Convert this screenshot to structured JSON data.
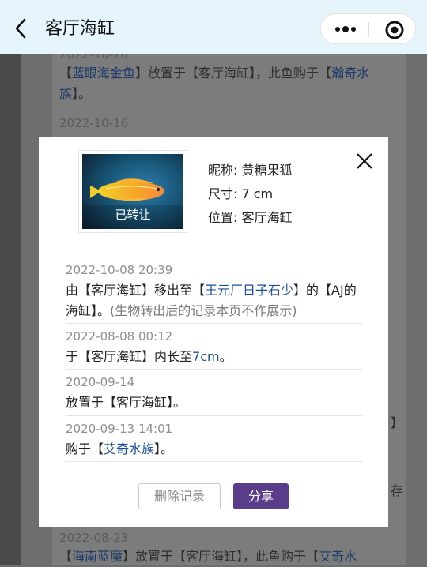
{
  "header": {
    "title": "客厅海缸",
    "back_icon": "chevron-left-icon",
    "more_icon": "more-dots-icon",
    "target_icon": "target-icon"
  },
  "background": {
    "entries": [
      {
        "date": "2022-10-20",
        "link": "蓝眼海金鱼",
        "text": "放置于【客厅海缸】，此鱼购于【",
        "link2": "瀚奇水族",
        "tail": "】。"
      },
      {
        "date": "2022-10-16"
      },
      {
        "date": "2022-08-23",
        "link": "海南蓝魔",
        "text": "放置于【客厅海缸】，此鱼购于【",
        "link2": "艾奇水",
        "tail": ""
      }
    ],
    "right_fragments": [
      "】",
      "存"
    ]
  },
  "modal": {
    "photo_stamp": "已转让",
    "nickname": "昵称: 黄糖果狐",
    "size": "尺寸: 7 cm",
    "location": "位置: 客厅海缸",
    "records": [
      {
        "date": "2022-10-08 20:39",
        "pre": "由【客厅海缸】移出至【",
        "link": "王元厂日子石少",
        "post": "】的【AJ的海缸】。",
        "note": "(生物转出后的记录本页不作展示)"
      },
      {
        "date": "2022-08-08 00:12",
        "pre": "于【客厅海缸】内长至",
        "link": "7cm",
        "post": "。"
      },
      {
        "date": "2020-09-14",
        "pre": "放置于【客厅海缸】。"
      },
      {
        "date": "2020-09-13 14:01",
        "pre": "购于【",
        "link": "艾奇水族",
        "post": "】。"
      }
    ],
    "delete_label": "删除记录",
    "share_label": "分享"
  }
}
